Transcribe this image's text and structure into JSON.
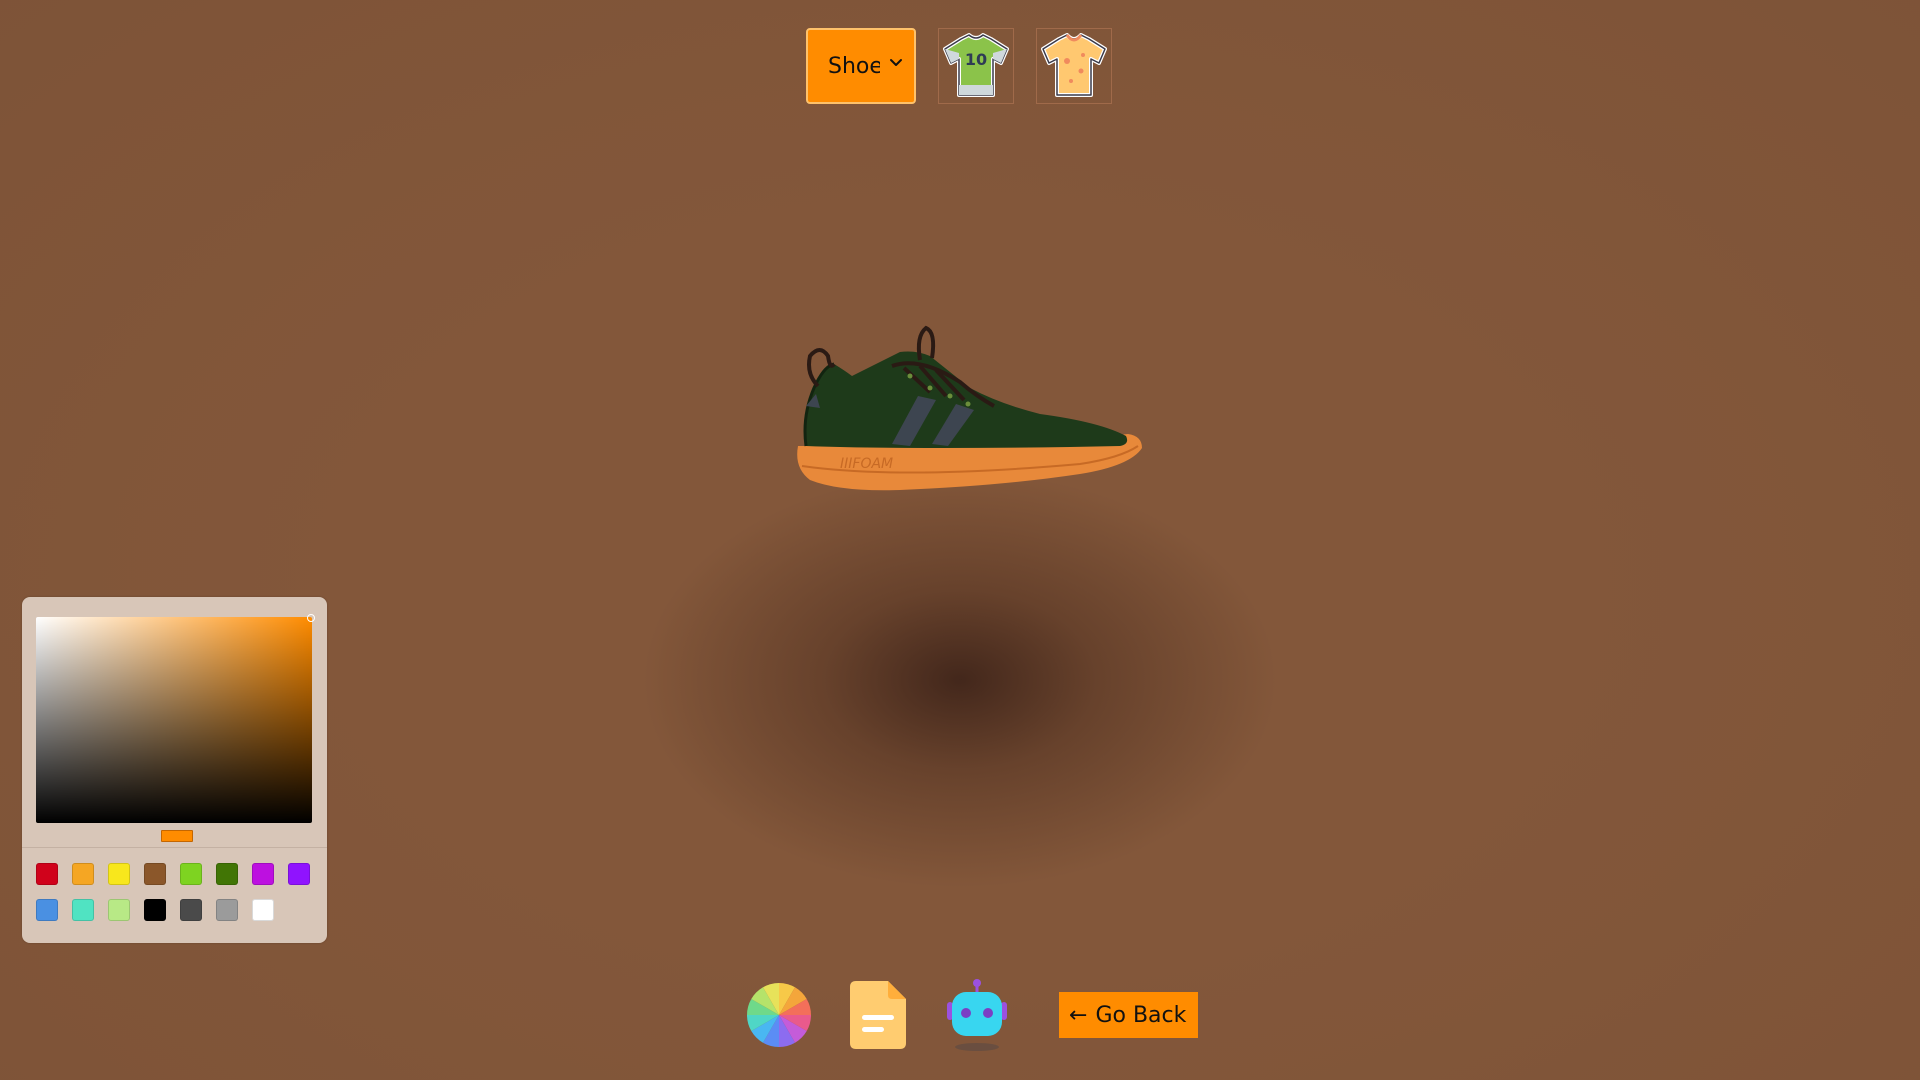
{
  "toolbar": {
    "model_select": {
      "selected": "Shoe"
    },
    "thumbnails": [
      {
        "icon": "jersey-icon",
        "label": "10"
      },
      {
        "icon": "tshirt-icon"
      }
    ]
  },
  "picker": {
    "current_color": "#ff8c00",
    "swatches": [
      "#d0021b",
      "#f5a623",
      "#f8e71c",
      "#8b572a",
      "#7ed321",
      "#417505",
      "#bd10e0",
      "#9013fe",
      "#4a90e2",
      "#50e3c2",
      "#b8e986",
      "#000000",
      "#4a4a4a",
      "#9b9b9b",
      "#ffffff"
    ]
  },
  "bottom_toolbar": {
    "tools": [
      {
        "icon": "color-wheel-icon"
      },
      {
        "icon": "file-icon"
      },
      {
        "icon": "ai-bot-icon"
      }
    ],
    "go_back": {
      "arrow": "←",
      "label": "Go Back"
    }
  },
  "colors": {
    "background": "#83573a",
    "accent": "#ff8c00",
    "shoe_upper": "#1e3a1a",
    "shoe_sole": "#e8893a"
  }
}
